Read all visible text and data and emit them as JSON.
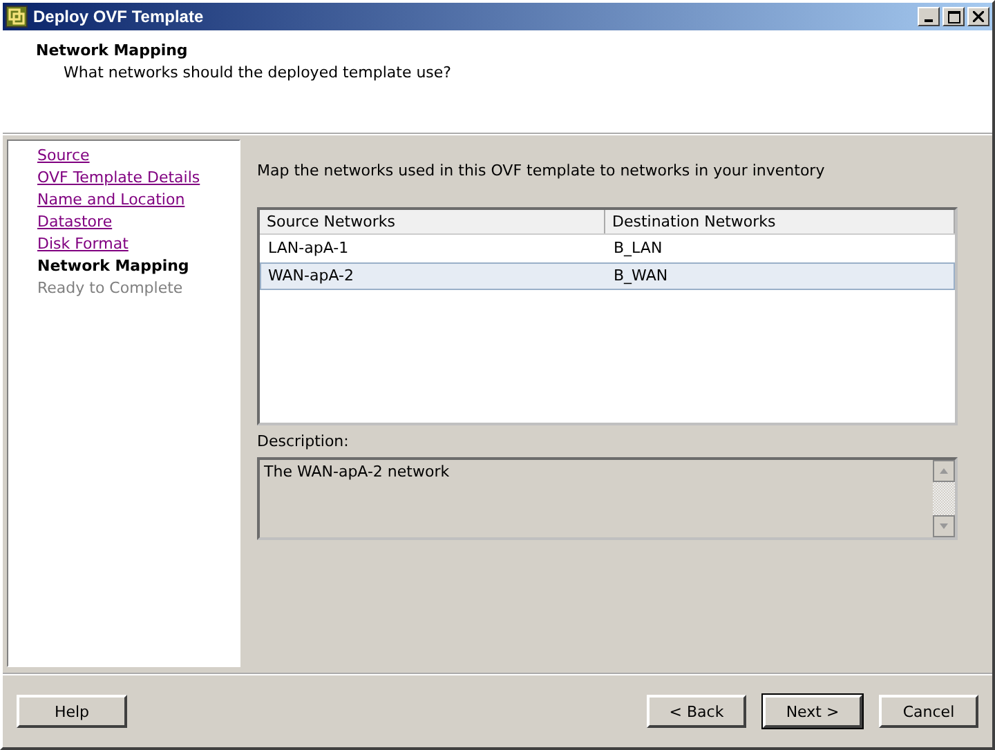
{
  "window": {
    "title": "Deploy OVF Template"
  },
  "header": {
    "title": "Network Mapping",
    "subtitle": "What networks should the deployed template use?"
  },
  "steps": [
    {
      "label": "Source",
      "kind": "link"
    },
    {
      "label": "OVF Template Details",
      "kind": "link"
    },
    {
      "label": "Name and Location",
      "kind": "link"
    },
    {
      "label": "Datastore",
      "kind": "link"
    },
    {
      "label": "Disk Format",
      "kind": "link"
    },
    {
      "label": "Network Mapping",
      "kind": "current"
    },
    {
      "label": "Ready to Complete",
      "kind": "pending"
    }
  ],
  "instruction": "Map the networks used in this OVF template to networks in your inventory",
  "table": {
    "columns": [
      "Source Networks",
      "Destination Networks"
    ],
    "rows": [
      {
        "cells": [
          "LAN-apA-1",
          "B_LAN"
        ],
        "selected": false
      },
      {
        "cells": [
          "WAN-apA-2",
          "B_WAN"
        ],
        "selected": true
      }
    ]
  },
  "description": {
    "label": "Description:",
    "text": "The WAN-apA-2 network"
  },
  "buttons": [
    {
      "label": "Help",
      "default": false
    },
    {
      "label": "< Back",
      "default": false
    },
    {
      "label": "Next >",
      "default": true
    },
    {
      "label": "Cancel",
      "default": false
    }
  ]
}
